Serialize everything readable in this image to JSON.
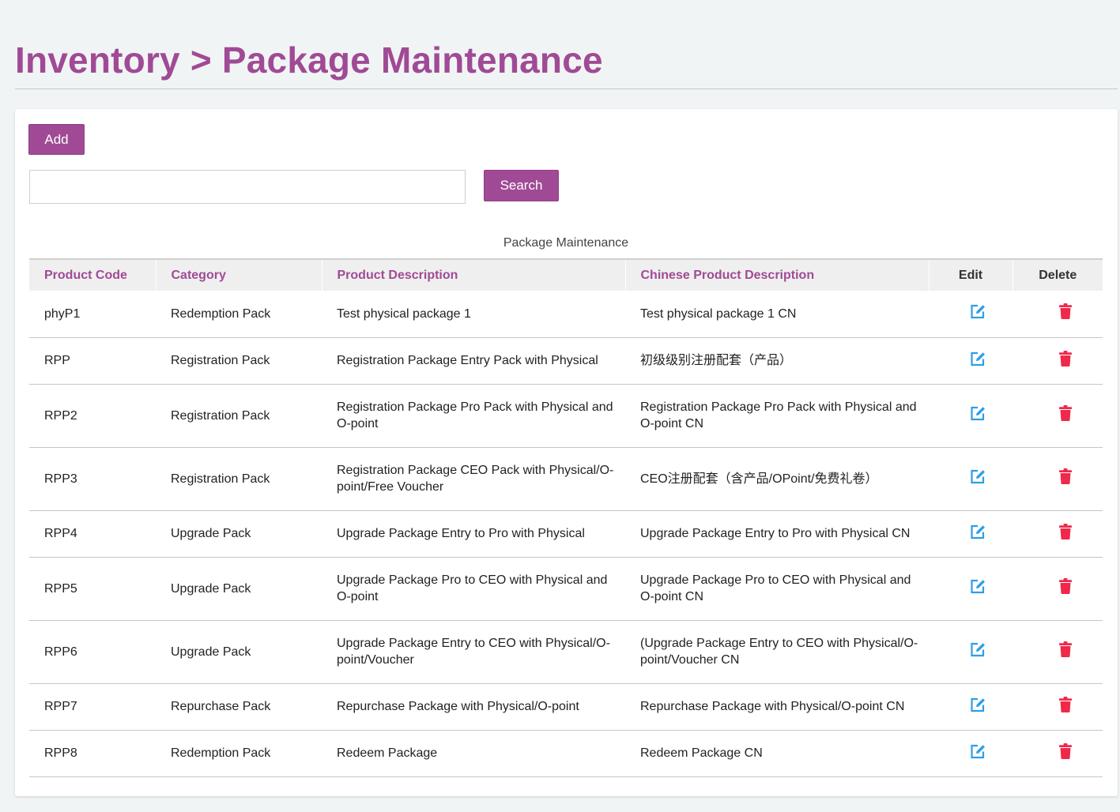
{
  "page": {
    "title": "Inventory > Package Maintenance"
  },
  "toolbar": {
    "add_label": "Add",
    "search_label": "Search",
    "search_value": "",
    "search_placeholder": ""
  },
  "table": {
    "caption": "Package Maintenance",
    "headers": {
      "code": "Product Code",
      "category": "Category",
      "description": "Product Description",
      "chinese_description": "Chinese Product Description",
      "edit": "Edit",
      "delete": "Delete"
    },
    "rows": [
      {
        "code": "phyP1",
        "category": "Redemption Pack",
        "description": "Test physical package 1",
        "chinese_description": "Test physical package 1 CN"
      },
      {
        "code": "RPP",
        "category": "Registration Pack",
        "description": "Registration Package Entry Pack with Physical",
        "chinese_description": "初级级别注册配套（产品）"
      },
      {
        "code": "RPP2",
        "category": "Registration Pack",
        "description": "Registration Package Pro Pack with Physical and O-point",
        "chinese_description": "Registration Package Pro Pack with Physical and O-point CN"
      },
      {
        "code": "RPP3",
        "category": "Registration Pack",
        "description": "Registration Package CEO Pack with Physical/O-point/Free Voucher",
        "chinese_description": "CEO注册配套（含产品/OPoint/免费礼卷）"
      },
      {
        "code": "RPP4",
        "category": "Upgrade Pack",
        "description": "Upgrade Package Entry to Pro with Physical",
        "chinese_description": "Upgrade Package Entry to Pro with Physical CN"
      },
      {
        "code": "RPP5",
        "category": "Upgrade Pack",
        "description": "Upgrade Package Pro to CEO with Physical and O-point",
        "chinese_description": "Upgrade Package Pro to CEO with Physical and O-point CN"
      },
      {
        "code": "RPP6",
        "category": "Upgrade Pack",
        "description": "Upgrade Package Entry to CEO with Physical/O-point/Voucher",
        "chinese_description": "(Upgrade Package Entry to CEO with Physical/O-point/Voucher CN"
      },
      {
        "code": "RPP7",
        "category": "Repurchase Pack",
        "description": "Repurchase Package with Physical/O-point",
        "chinese_description": "Repurchase Package with Physical/O-point CN"
      },
      {
        "code": "RPP8",
        "category": "Redemption Pack",
        "description": "Redeem Package",
        "chinese_description": "Redeem Package CN"
      }
    ]
  },
  "icons": {
    "edit": "edit-icon",
    "delete": "trash-icon"
  },
  "colors": {
    "accent": "#a04a96",
    "edit_icon": "#2e9ee6",
    "delete_icon": "#f0284a",
    "header_bg": "#efefef"
  }
}
